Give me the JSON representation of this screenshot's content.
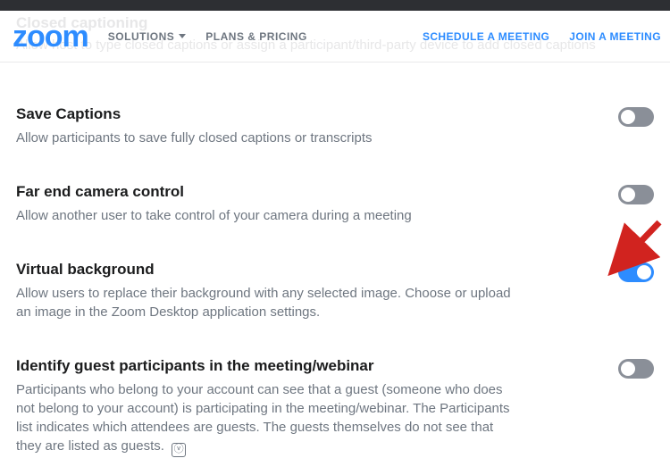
{
  "ghost": {
    "title": "Closed captioning",
    "desc": "Allow host to type closed captions or assign a participant/third-party device to add closed captions"
  },
  "header": {
    "logo": "zoom",
    "nav_left": [
      {
        "label": "SOLUTIONS",
        "has_caret": true
      },
      {
        "label": "PLANS & PRICING",
        "has_caret": false
      }
    ],
    "nav_right": [
      {
        "label": "SCHEDULE A MEETING"
      },
      {
        "label": "JOIN A MEETING"
      }
    ]
  },
  "settings": [
    {
      "key": "save_captions",
      "title": "Save Captions",
      "desc": "Allow participants to save fully closed captions or transcripts",
      "on": false
    },
    {
      "key": "far_end_camera",
      "title": "Far end camera control",
      "desc": "Allow another user to take control of your camera during a meeting",
      "on": false
    },
    {
      "key": "virtual_background",
      "title": "Virtual background",
      "desc": "Allow users to replace their background with any selected image. Choose or upload an image in the Zoom Desktop application settings.",
      "on": true
    },
    {
      "key": "identify_guests",
      "title": "Identify guest participants in the meeting/webinar",
      "desc": "Participants who belong to your account can see that a guest (someone who does not belong to your account) is participating in the meeting/webinar. The Participants list indicates which attendees are guests. The guests themselves do not see that they are listed as guests.",
      "on": false,
      "info": true
    }
  ],
  "info_glyph": "ⓥ",
  "colors": {
    "accent": "#2d8cff",
    "arrow": "#d1231f"
  }
}
